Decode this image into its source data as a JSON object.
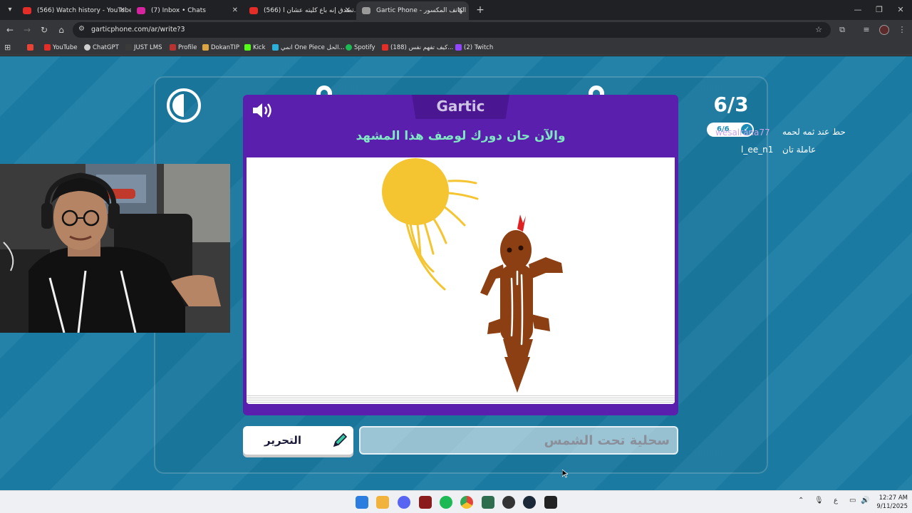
{
  "browser": {
    "tabs": [
      {
        "title": "(566) Watch history - YouTube",
        "active": false,
        "favicon_color": "#e52d27"
      },
      {
        "title": "(7) Inbox • Chats",
        "active": false,
        "favicon_color": "#d6249f"
      },
      {
        "title": "(566) تصدق إنه باع كليته عشان ا...",
        "active": false,
        "favicon_color": "#e52d27"
      },
      {
        "title": "Gartic Phone - الهاتف المكسور",
        "active": true,
        "favicon_color": "#9a9a9a"
      }
    ],
    "url": "garticphone.com/ar/write?3",
    "bookmarks": [
      {
        "label": "",
        "icon_color": "#ea4335"
      },
      {
        "label": "YouTube",
        "icon_color": "#e52d27"
      },
      {
        "label": "ChatGPT",
        "icon_color": "#cfcfcf"
      },
      {
        "label": "JUST LMS",
        "icon_color": "#3a3a3a"
      },
      {
        "label": "Profile",
        "icon_color": "#b83232"
      },
      {
        "label": "DokanTIP",
        "icon_color": "#d9a441"
      },
      {
        "label": "Kick",
        "icon_color": "#53fc18"
      },
      {
        "label": "انمي One Piece الحل...",
        "icon_color": "#2ab0d9"
      },
      {
        "label": "Spotify",
        "icon_color": "#1db954"
      },
      {
        "label": "(188) كيف تفهم نفس...",
        "icon_color": "#e52d27"
      },
      {
        "label": "(2) Twitch",
        "icon_color": "#9146ff"
      }
    ]
  },
  "game": {
    "logo": "Gartic",
    "prompt": "والآن حان دورك لوصف هذا المشهد",
    "edit_button": "التحرير",
    "answer_value": "سحلية تحت الشمس",
    "round": "6/3",
    "done_count": "6/6",
    "players": [
      {
        "name": "wesalrana77",
        "text": "حط عند ثمه لحمه",
        "faded": true
      },
      {
        "name": "l_ee_n1",
        "text": "عاملة تان",
        "faded": false
      }
    ],
    "timer_remaining": 0.5
  },
  "taskbar": {
    "icons": [
      {
        "name": "windows-start-icon",
        "color": "#2b7ee0"
      },
      {
        "name": "file-explorer-icon",
        "color": "#f2b33d"
      },
      {
        "name": "discord-icon",
        "color": "#5865f2"
      },
      {
        "name": "voicemeeter-icon",
        "color": "#8a1c1c"
      },
      {
        "name": "spotify-icon",
        "color": "#1db954"
      },
      {
        "name": "chrome-icon",
        "color": "#e4433a"
      },
      {
        "name": "app-icon",
        "color": "#2f6d4f"
      },
      {
        "name": "obs-icon",
        "color": "#333333"
      },
      {
        "name": "steam-icon",
        "color": "#1b2838"
      },
      {
        "name": "terminal-icon",
        "color": "#222222"
      }
    ],
    "language": "ع",
    "time": "12:27 AM",
    "date": "9/11/2025"
  },
  "colors": {
    "page_background": "#1c7ea6",
    "notebook": "#5b1fae",
    "prompt_text": "#7fe8c2",
    "sun": "#f4c531",
    "drawing_brown": "#8b3f12",
    "drawing_red": "#e02020"
  }
}
